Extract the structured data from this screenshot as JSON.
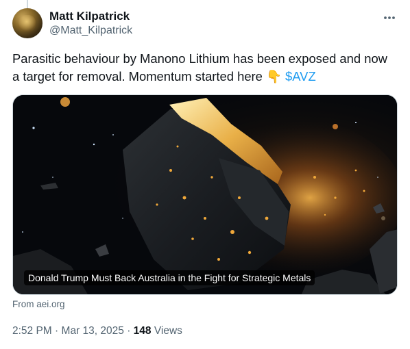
{
  "author": {
    "display_name": "Matt Kilpatrick",
    "handle": "@Matt_Kilpatrick",
    "avatar_icon": "avatar-photo"
  },
  "tweet": {
    "text_before": "Parasitic behaviour by Manono Lithium has been exposed and now a target for removal. Momentum started here ",
    "emoji": "👇",
    "cashtag": "$AVZ"
  },
  "card": {
    "caption": "Donald Trump Must Back Australia in the Fight for Strategic Metals",
    "source_label": "From aei.org"
  },
  "meta": {
    "time": "2:52 PM",
    "separator": "·",
    "date": "Mar 13, 2025",
    "views_count": "148",
    "views_label": "Views"
  },
  "colors": {
    "link": "#1d9bf0",
    "text": "#0f1419",
    "secondary": "#536471",
    "border": "#cfd9de"
  },
  "icons": {
    "more": "more-horizontal-icon"
  }
}
